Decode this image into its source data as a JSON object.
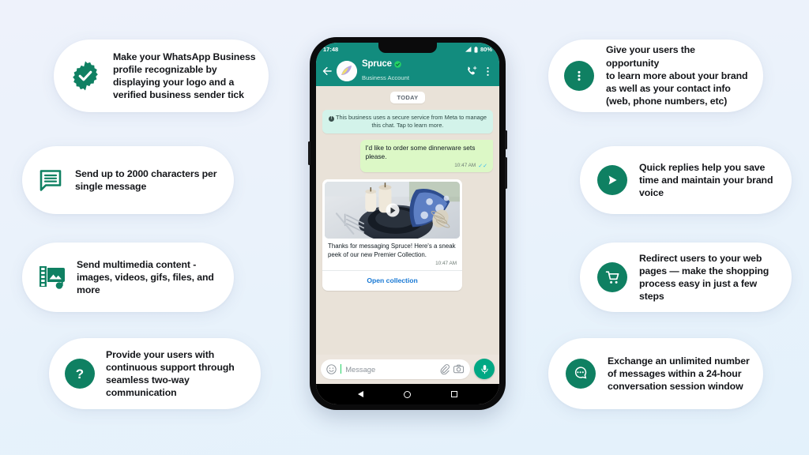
{
  "theme": {
    "bg_top": "#eef2fb",
    "bg_bottom": "#e3f1fb",
    "brand_green": "#0f8062",
    "whatsapp_header": "#128c7e",
    "bubble_out": "#dcf8c6",
    "link_blue": "#1778d4"
  },
  "cards": {
    "verified": {
      "icon": "verified-badge-icon",
      "text": "Make your WhatsApp Business\nprofile recognizable by\ndisplaying your logo and a\nverified business sender tick"
    },
    "characters": {
      "icon": "chat-lines-icon",
      "text": "Send up to 2000 characters per\nsingle message"
    },
    "multimedia": {
      "icon": "film-media-icon",
      "text": "Send multimedia content -\nimages, videos, gifs, files, and\nmore"
    },
    "support": {
      "icon": "question-mark-icon",
      "text": "Provide your users with\ncontinuous support through\nseamless two-way\ncommunication"
    },
    "profile": {
      "icon": "three-dots-menu-icon",
      "text": "Give your users the opportunity\nto learn more about your brand\nas well as your contact info\n(web, phone numbers, etc)"
    },
    "replies": {
      "icon": "send-arrow-icon",
      "text": "Quick replies help you save\ntime and maintain your brand\nvoice"
    },
    "redirect": {
      "icon": "shopping-cart-icon",
      "text": "Redirect users to your web\npages — make the shopping\nprocess easy in just a few steps"
    },
    "session": {
      "icon": "chat-bubbles-icon",
      "text": "Exchange an unlimited number\nof messages within a 24-hour\nconversation session window"
    }
  },
  "phone": {
    "status_bar": {
      "time": "17:48",
      "battery": "80%"
    },
    "chat_header": {
      "back_icon": "back-arrow-icon",
      "avatar": "contact-avatar",
      "name": "Spruce",
      "verified_icon": "verified-check-icon",
      "subtitle": "Business Account",
      "call_icon": "add-call-icon",
      "menu_icon": "overflow-menu-icon"
    },
    "chat": {
      "day_label": "TODAY",
      "system_notice": "This business uses a secure service from Meta to manage this chat. Tap to learn more.",
      "messages": [
        {
          "type": "outgoing-text",
          "text": "I'd like to order some dinnerware sets please.",
          "time": "10:47 AM",
          "ticks": "read"
        },
        {
          "type": "incoming-media-card",
          "media": "dinnerware-table-setting-video",
          "text": "Thanks for messaging Spruce! Here's a sneak peek of our new Premier Collection.",
          "time": "10:47 AM",
          "cta_label": "Open collection"
        }
      ]
    },
    "input_bar": {
      "emoji_icon": "emoji-smiley-icon",
      "placeholder": "Message",
      "attach_icon": "paperclip-icon",
      "camera_icon": "camera-icon",
      "mic_icon": "microphone-icon"
    },
    "nav_bar": {
      "back": "nav-back-triangle",
      "home": "nav-home-circle",
      "recents": "nav-recents-square"
    }
  }
}
